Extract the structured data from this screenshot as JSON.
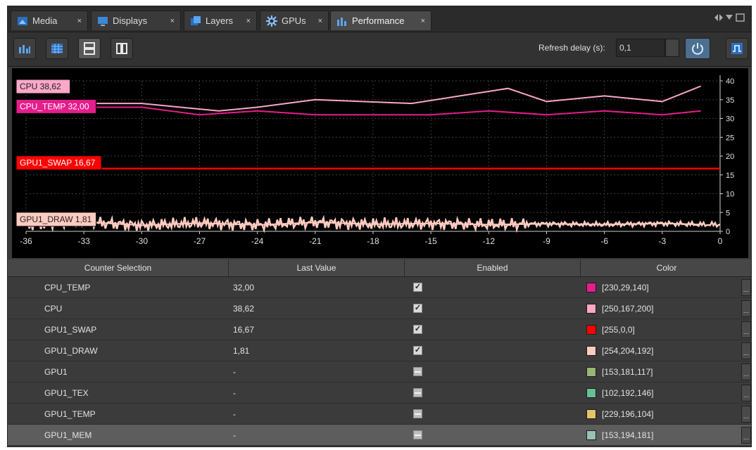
{
  "tabs": [
    {
      "label": "Media",
      "icon": "media-icon"
    },
    {
      "label": "Displays",
      "icon": "display-icon"
    },
    {
      "label": "Layers",
      "icon": "layers-icon"
    },
    {
      "label": "GPUs",
      "icon": "gpu-icon"
    },
    {
      "label": "Performance",
      "icon": "performance-icon",
      "active": true
    }
  ],
  "tab_close": "×",
  "toolbar": {
    "refresh_label": "Refresh delay (s):",
    "refresh_value": "0,1"
  },
  "chart_data": {
    "type": "line",
    "xlim": [
      -36,
      0
    ],
    "ylim": [
      0,
      40
    ],
    "x_ticks": [
      "-36",
      "-33",
      "-30",
      "-27",
      "-24",
      "-21",
      "-18",
      "-15",
      "-12",
      "-9",
      "-6",
      "-3",
      "0"
    ],
    "y_ticks": [
      "0",
      "5",
      "10",
      "15",
      "20",
      "25",
      "30",
      "35",
      "40"
    ],
    "grid": true,
    "series": [
      {
        "name": "CPU",
        "label": "CPU 38,62",
        "color": "#faa7c8",
        "x": [
          -36,
          -30,
          -26,
          -24,
          -21,
          -16,
          -11,
          -9,
          -6,
          -3,
          -1
        ],
        "y": [
          34,
          34,
          32,
          33,
          35,
          34,
          38,
          34.5,
          36,
          34.5,
          38.6
        ]
      },
      {
        "name": "CPU_TEMP",
        "label": "CPU_TEMP 32,00",
        "color": "#e61d8c",
        "x": [
          -36,
          -33,
          -30,
          -27,
          -24,
          -21,
          -18,
          -15,
          -12,
          -9,
          -6,
          -3,
          -1
        ],
        "y": [
          33,
          33,
          33,
          31,
          32,
          31,
          31,
          31,
          32,
          31,
          32,
          31,
          32
        ]
      },
      {
        "name": "GPU1_SWAP",
        "label": "GPU1_SWAP 16,67",
        "color": "#ff0000",
        "x": [
          -36,
          0
        ],
        "y": [
          16.67,
          16.67
        ]
      },
      {
        "name": "GPU1_DRAW",
        "label": "GPU1_DRAW 1,81",
        "color": "#fecbc0",
        "x": [
          -36,
          -33,
          -30,
          -27,
          -24,
          -21,
          -18,
          -15,
          -12,
          -9,
          -6,
          -3,
          -1
        ],
        "y": [
          1.8,
          2.5,
          1.6,
          2.2,
          1.7,
          2.4,
          1.9,
          2.1,
          1.8,
          2.0,
          1.8,
          2.1,
          1.81
        ]
      }
    ]
  },
  "table": {
    "headers": [
      "Counter Selection",
      "Last Value",
      "Enabled",
      "Color"
    ],
    "rows": [
      {
        "name": "CPU_TEMP",
        "value": "32,00",
        "enabled": true,
        "color_text": "[230,29,140]",
        "color": "#e61d8c"
      },
      {
        "name": "CPU",
        "value": "38,62",
        "enabled": true,
        "color_text": "[250,167,200]",
        "color": "#faa7c8"
      },
      {
        "name": "GPU1_SWAP",
        "value": "16,67",
        "enabled": true,
        "color_text": "[255,0,0]",
        "color": "#ff0000"
      },
      {
        "name": "GPU1_DRAW",
        "value": "1,81",
        "enabled": true,
        "color_text": "[254,204,192]",
        "color": "#fecbc0"
      },
      {
        "name": "GPU1",
        "value": "-",
        "enabled": false,
        "color_text": "[153,181,117]",
        "color": "#99b575"
      },
      {
        "name": "GPU1_TEX",
        "value": "-",
        "enabled": false,
        "color_text": "[102,192,146]",
        "color": "#66c092"
      },
      {
        "name": "GPU1_TEMP",
        "value": "-",
        "enabled": false,
        "color_text": "[229,196,104]",
        "color": "#e5c468"
      },
      {
        "name": "GPU1_MEM",
        "value": "-",
        "enabled": false,
        "color_text": "[153,194,181]",
        "color": "#99c2b5",
        "selected": true
      }
    ],
    "more_button": "...",
    "check_mark": "✓"
  }
}
